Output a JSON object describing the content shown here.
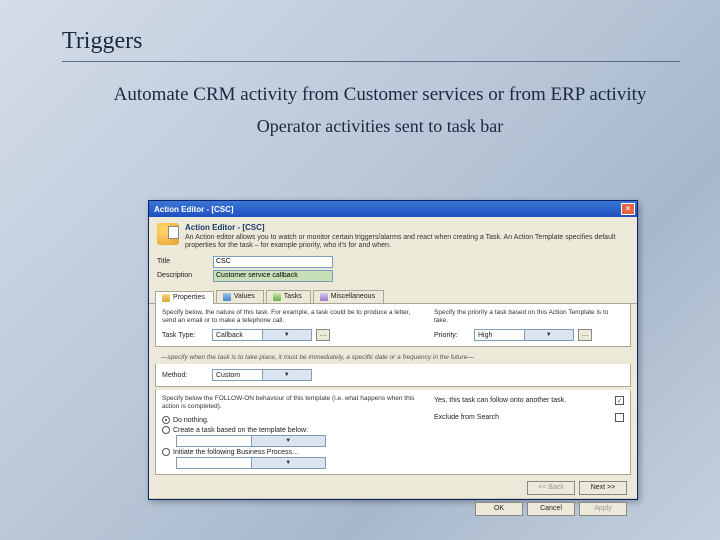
{
  "slide": {
    "title": "Triggers",
    "subtitle1": "Automate CRM activity from Customer services or from ERP activity",
    "subtitle2": "Operator activities sent to task bar"
  },
  "dialog": {
    "title": "Action Editor - [CSC]",
    "close": "×",
    "header": {
      "title": "Action Editor - [CSC]",
      "desc": "An Action editor allows you to watch or monitor certain triggers/alarms and react when creating a Task. An Action Template specifies default properties for the task – for example priority, who it's for and when."
    },
    "fields": {
      "title_label": "Title",
      "title_value": "CSC",
      "description_label": "Description",
      "description_value": "Customer service callback"
    },
    "tabs": {
      "properties": "Properties",
      "values": "Values",
      "tasks": "Tasks",
      "misc": "Miscellaneous"
    },
    "properties": {
      "left_help": "Specify below, the nature of this task. For example, a task could be to produce a letter, send an email or to make a telephone call.",
      "task_type_label": "Task Type:",
      "task_type_value": "Callback",
      "task_type_dots": "…",
      "right_help": "Specify the priority a task based on this Action Template is to take.",
      "priority_label": "Priority:",
      "priority_value": "High",
      "priority_dots": "…"
    },
    "when_text": "—specify when the task is to take place, it must be immediately, a specific date or a frequency in the future—",
    "method": {
      "label": "Method:",
      "value": "Custom"
    },
    "followon": {
      "help": "Specify below the FOLLOW-ON behaviour of this template (i.e. what happens when this action is completed).",
      "radio_nothing": "Do nothing.",
      "radio_create": "Create a task based on the template below:",
      "radio_initiate": "Initiate the following Business Process…",
      "select1_placeholder": "",
      "select2_placeholder": ""
    },
    "right_options": {
      "allow_label": "Yes, this task can follow onto another task.",
      "allow_checked": true,
      "exclude_label": "Exclude from Search",
      "exclude_checked": false
    },
    "wizard": {
      "back": "<< Back",
      "next": "Next >>"
    },
    "footer": {
      "ok": "OK",
      "cancel": "Cancel",
      "apply": "Apply"
    }
  }
}
